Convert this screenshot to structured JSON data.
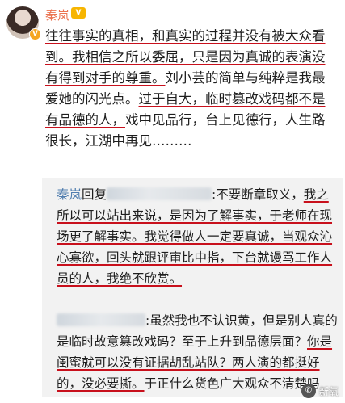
{
  "user": {
    "name": "秦岚",
    "member_badge": "V",
    "verified_badge": "V"
  },
  "post": {
    "s1": "往往事实的真相，和真实的过程并没有被大众看到。",
    "s2": "我相信之所以委屈，只是因为真诚的表演没有得到对手的尊重。",
    "s3": "刘小芸的简单与纯粹是我最爱她的闪光点。",
    "s4": "过于自大，临时篡改戏码都不是有品德的人，",
    "s5": "戏中见品行，台上见德行，人生路很长，江湖中再见………"
  },
  "reply1": {
    "author": "秦岚",
    "reply_word": "回复",
    "p1": ":不要断章取义，",
    "p2": "我之所以可以站出来说，是因为了解事实，于老师在现场更了解事实。",
    "p3": "我觉得做人一定要真诚，当观众沁心寡欲，回头就跟评审比中指，",
    "p4": "下台就谩骂工作人员的人，我绝不欣赏。"
  },
  "reply2": {
    "p1": ":虽然我也不认识黄，但是别人真的是临时故意篡改戏码？至于上升到品德层面？",
    "p2": "你是闺蜜就可以没有证据胡乱站队？两人演的都挺好的，没必要撕。",
    "p3": "于正什么货色广大观众不清楚吗"
  },
  "watermark": {
    "label": "新氧",
    "icon": "wechat-icon"
  },
  "colors": {
    "username": "#eb7350",
    "link": "#507daf",
    "underline": "#c8101c"
  }
}
